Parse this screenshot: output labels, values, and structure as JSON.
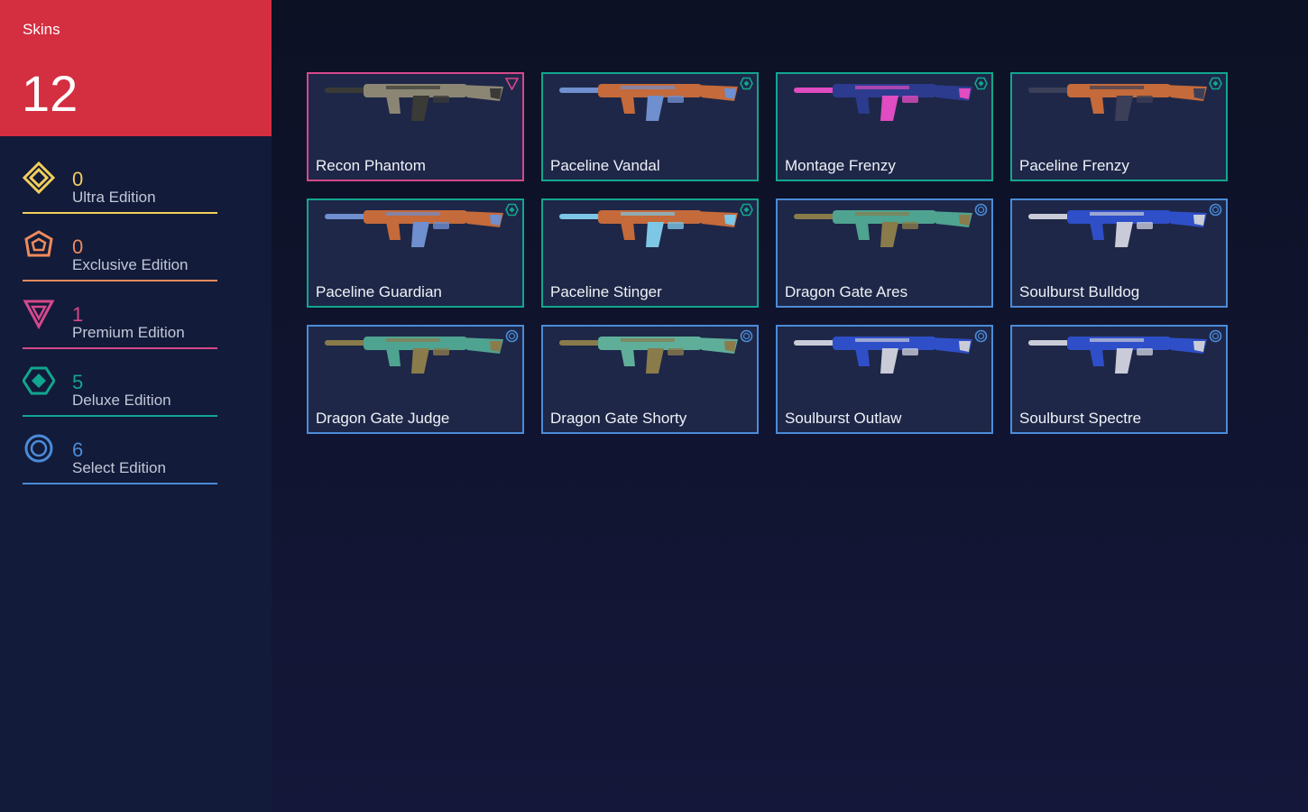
{
  "sidebar": {
    "title": "Skins",
    "total": "12",
    "tiers": [
      {
        "count": "0",
        "label": "Ultra Edition",
        "color": "#f2cf5b",
        "icon": "ultra-edition-icon"
      },
      {
        "count": "0",
        "label": "Exclusive Edition",
        "color": "#ee8a5c",
        "icon": "exclusive-edition-icon"
      },
      {
        "count": "1",
        "label": "Premium Edition",
        "color": "#d6488c",
        "icon": "premium-edition-icon"
      },
      {
        "count": "5",
        "label": "Deluxe Edition",
        "color": "#12a58f",
        "icon": "deluxe-edition-icon"
      },
      {
        "count": "6",
        "label": "Select Edition",
        "color": "#4b8bd8",
        "icon": "select-edition-icon"
      }
    ]
  },
  "skins": [
    {
      "name": "Recon Phantom",
      "tier": "premium",
      "border": "#d6488c",
      "gun_colors": [
        "#8b8674",
        "#3a3a36"
      ]
    },
    {
      "name": "Paceline Vandal",
      "tier": "deluxe",
      "border": "#12a58f",
      "gun_colors": [
        "#c46a3b",
        "#6f8fcf"
      ]
    },
    {
      "name": "Montage Frenzy",
      "tier": "deluxe",
      "border": "#12a58f",
      "gun_colors": [
        "#2c3b8e",
        "#e04cc1"
      ]
    },
    {
      "name": "Paceline Frenzy",
      "tier": "deluxe",
      "border": "#12a58f",
      "gun_colors": [
        "#c46a3b",
        "#3b3f58"
      ]
    },
    {
      "name": "Paceline Guardian",
      "tier": "deluxe",
      "border": "#12a58f",
      "gun_colors": [
        "#c46a3b",
        "#6f8fcf"
      ]
    },
    {
      "name": "Paceline Stinger",
      "tier": "deluxe",
      "border": "#12a58f",
      "gun_colors": [
        "#c46a3b",
        "#7dc6e6"
      ]
    },
    {
      "name": "Dragon Gate Ares",
      "tier": "select",
      "border": "#4b8bd8",
      "gun_colors": [
        "#4fa391",
        "#8a7b4b"
      ]
    },
    {
      "name": "Soulburst Bulldog",
      "tier": "select",
      "border": "#4b8bd8",
      "gun_colors": [
        "#2f4fc8",
        "#c9ccd8"
      ]
    },
    {
      "name": "Dragon Gate Judge",
      "tier": "select",
      "border": "#4b8bd8",
      "gun_colors": [
        "#4fa391",
        "#8a7b4b"
      ]
    },
    {
      "name": "Dragon Gate Shorty",
      "tier": "select",
      "border": "#4b8bd8",
      "gun_colors": [
        "#5fae9a",
        "#8a7b4b"
      ]
    },
    {
      "name": "Soulburst Outlaw",
      "tier": "select",
      "border": "#4b8bd8",
      "gun_colors": [
        "#2f4fc8",
        "#c9ccd8"
      ]
    },
    {
      "name": "Soulburst Spectre",
      "tier": "select",
      "border": "#4b8bd8",
      "gun_colors": [
        "#2f4fc8",
        "#c9ccd8"
      ]
    }
  ]
}
